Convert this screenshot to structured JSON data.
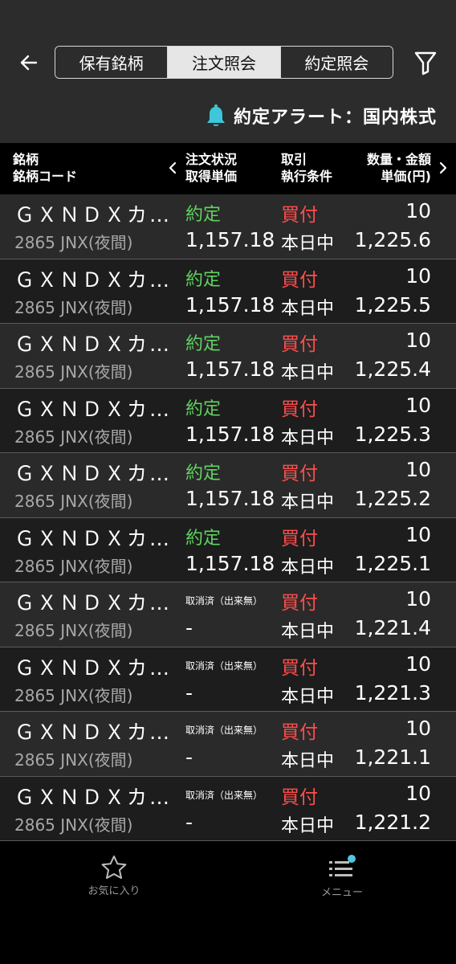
{
  "header": {
    "tabs": [
      "保有銘柄",
      "注文照会",
      "約定照会"
    ],
    "active_tab_index": 1,
    "alert_label": "約定アラート：国内株式"
  },
  "columns": {
    "name_line1": "銘柄",
    "name_line2": "銘柄コード",
    "status_line1": "注文状況",
    "status_line2": "取得単価",
    "trade_line1": "取引",
    "trade_line2": "執行条件",
    "qty_line1": "数量・金額",
    "qty_line2": "単価(円)"
  },
  "rows": [
    {
      "name": "ＧＸＮＤＸカ…",
      "code": "2865 JNX(夜間)",
      "status": "約定",
      "price": "1,157.18",
      "side": "買付",
      "condition": "本日中",
      "quantity": "10",
      "unit_price": "1,225.6"
    },
    {
      "name": "ＧＸＮＤＸカ…",
      "code": "2865 JNX(夜間)",
      "status": "約定",
      "price": "1,157.18",
      "side": "買付",
      "condition": "本日中",
      "quantity": "10",
      "unit_price": "1,225.5"
    },
    {
      "name": "ＧＸＮＤＸカ…",
      "code": "2865 JNX(夜間)",
      "status": "約定",
      "price": "1,157.18",
      "side": "買付",
      "condition": "本日中",
      "quantity": "10",
      "unit_price": "1,225.4"
    },
    {
      "name": "ＧＸＮＤＸカ…",
      "code": "2865 JNX(夜間)",
      "status": "約定",
      "price": "1,157.18",
      "side": "買付",
      "condition": "本日中",
      "quantity": "10",
      "unit_price": "1,225.3"
    },
    {
      "name": "ＧＸＮＤＸカ…",
      "code": "2865 JNX(夜間)",
      "status": "約定",
      "price": "1,157.18",
      "side": "買付",
      "condition": "本日中",
      "quantity": "10",
      "unit_price": "1,225.2"
    },
    {
      "name": "ＧＸＮＤＸカ…",
      "code": "2865 JNX(夜間)",
      "status": "約定",
      "price": "1,157.18",
      "side": "買付",
      "condition": "本日中",
      "quantity": "10",
      "unit_price": "1,225.1"
    },
    {
      "name": "ＧＸＮＤＸカ…",
      "code": "2865 JNX(夜間)",
      "status": "取消済（出来無）",
      "price": "-",
      "side": "買付",
      "condition": "本日中",
      "quantity": "10",
      "unit_price": "1,221.4"
    },
    {
      "name": "ＧＸＮＤＸカ…",
      "code": "2865 JNX(夜間)",
      "status": "取消済（出来無）",
      "price": "-",
      "side": "買付",
      "condition": "本日中",
      "quantity": "10",
      "unit_price": "1,221.3"
    },
    {
      "name": "ＧＸＮＤＸカ…",
      "code": "2865 JNX(夜間)",
      "status": "取消済（出来無）",
      "price": "-",
      "side": "買付",
      "condition": "本日中",
      "quantity": "10",
      "unit_price": "1,221.1"
    },
    {
      "name": "ＧＸＮＤＸカ…",
      "code": "2865 JNX(夜間)",
      "status": "取消済（出来無）",
      "price": "-",
      "side": "買付",
      "condition": "本日中",
      "quantity": "10",
      "unit_price": "1,221.2"
    }
  ],
  "bottom_nav": {
    "favorites_label": "お気に入り",
    "menu_label": "メニュー"
  },
  "colors": {
    "executed": "#5fd35f",
    "buy": "#ff4d4d",
    "header_bg": "#2c2c2c",
    "bell": "#3ec6d9",
    "menu_badge": "#4ec8e0"
  },
  "icons": {
    "back": "back-arrow-icon",
    "filter": "filter-icon",
    "alert": "bell-icon",
    "favorites": "star-icon",
    "menu": "list-menu-icon"
  }
}
